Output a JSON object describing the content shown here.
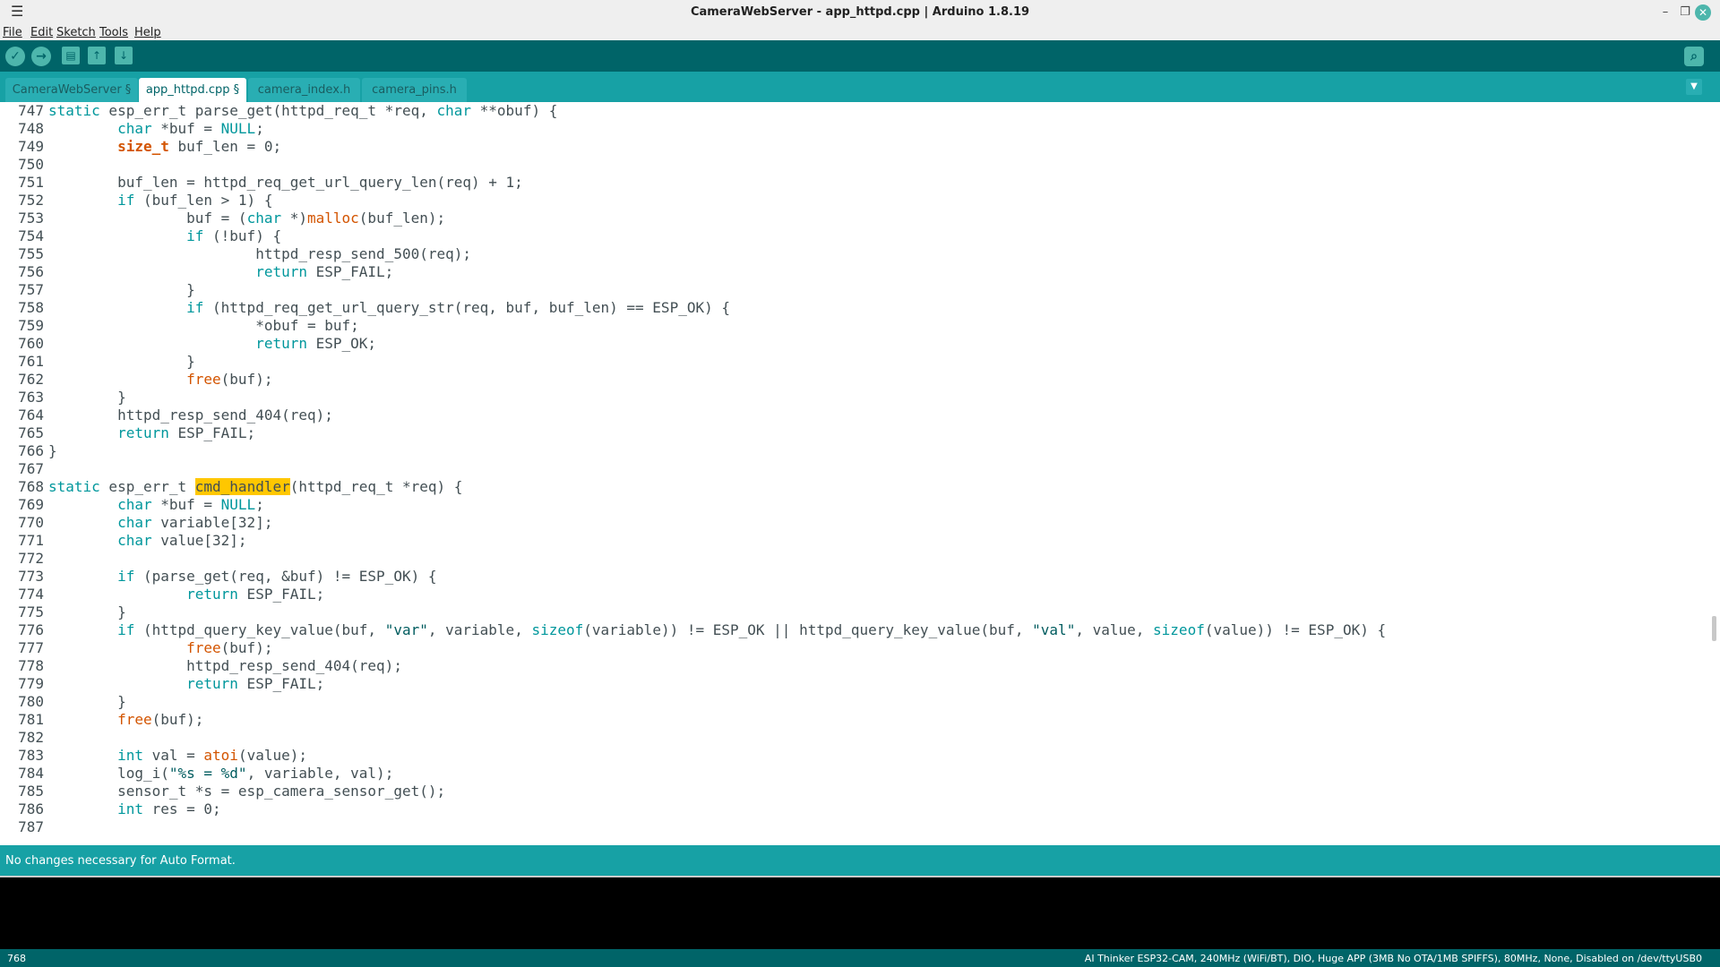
{
  "window": {
    "title": "CameraWebServer - app_httpd.cpp | Arduino 1.8.19",
    "hamburger_icon": "menu-icon",
    "minimize": "–",
    "restore": "❐",
    "close": "✕"
  },
  "menu": [
    "File",
    "Edit",
    "Sketch",
    "Tools",
    "Help"
  ],
  "toolbar": {
    "verify": "✓",
    "upload": "→",
    "new": "▤",
    "open": "↑",
    "save": "↓",
    "serial_monitor": "⌕"
  },
  "tabs": [
    {
      "label": "CameraWebServer §"
    },
    {
      "label": "app_httpd.cpp §"
    },
    {
      "label": "camera_index.h"
    },
    {
      "label": "camera_pins.h"
    }
  ],
  "tab_menu": "▼",
  "code": {
    "line_numbers": [
      "747",
      "748",
      "749",
      "750",
      "751",
      "752",
      "753",
      "754",
      "755",
      "756",
      "757",
      "758",
      "759",
      "760",
      "761",
      "762",
      "763",
      "764",
      "765",
      "766",
      "767",
      "768",
      "769",
      "770",
      "771",
      "772",
      "773",
      "774",
      "775",
      "776",
      "777",
      "778",
      "779",
      "780",
      "781",
      "782",
      "783",
      "784",
      "785",
      "786",
      "787"
    ]
  },
  "status": {
    "message": "No changes necessary for Auto Format."
  },
  "footer": {
    "line": "768",
    "board": "AI Thinker ESP32-CAM, 240MHz (WiFi/BT), DIO, Huge APP (3MB No OTA/1MB SPIFFS), 80MHz, None, Disabled on /dev/ttyUSB0"
  },
  "colors": {
    "toolbar": "#006468",
    "tabbar": "#17a1a5",
    "highlight": "#ffc700"
  }
}
